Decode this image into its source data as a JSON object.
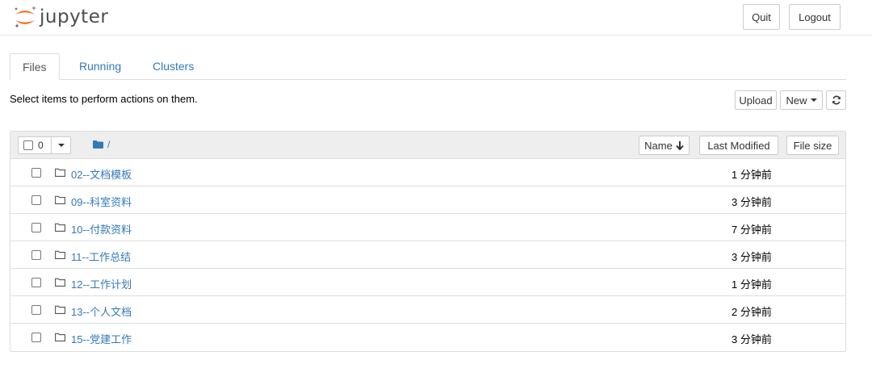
{
  "header": {
    "logo_text": "jupyter",
    "quit_label": "Quit",
    "logout_label": "Logout"
  },
  "tabs": [
    {
      "label": "Files",
      "active": true
    },
    {
      "label": "Running",
      "active": false
    },
    {
      "label": "Clusters",
      "active": false
    }
  ],
  "toolbar": {
    "hint": "Select items to perform actions on them.",
    "upload_label": "Upload",
    "new_label": "New",
    "refresh_icon": "refresh-icon"
  },
  "list_header": {
    "selected_count": "0",
    "breadcrumb_path": "/",
    "sort_name_label": "Name",
    "sort_modified_label": "Last Modified",
    "sort_size_label": "File size"
  },
  "files": [
    {
      "name": "02--文档模板",
      "modified": "1 分钟前"
    },
    {
      "name": "09--科室资料",
      "modified": "3 分钟前"
    },
    {
      "name": "10--付款资料",
      "modified": "7 分钟前"
    },
    {
      "name": "11--工作总结",
      "modified": "3 分钟前"
    },
    {
      "name": "12--工作计划",
      "modified": "1 分钟前"
    },
    {
      "name": "13--个人文档",
      "modified": "2 分钟前"
    },
    {
      "name": "15--党建工作",
      "modified": "3 分钟前"
    }
  ],
  "colors": {
    "link": "#337ab7",
    "logo_orange": "#f37726"
  }
}
